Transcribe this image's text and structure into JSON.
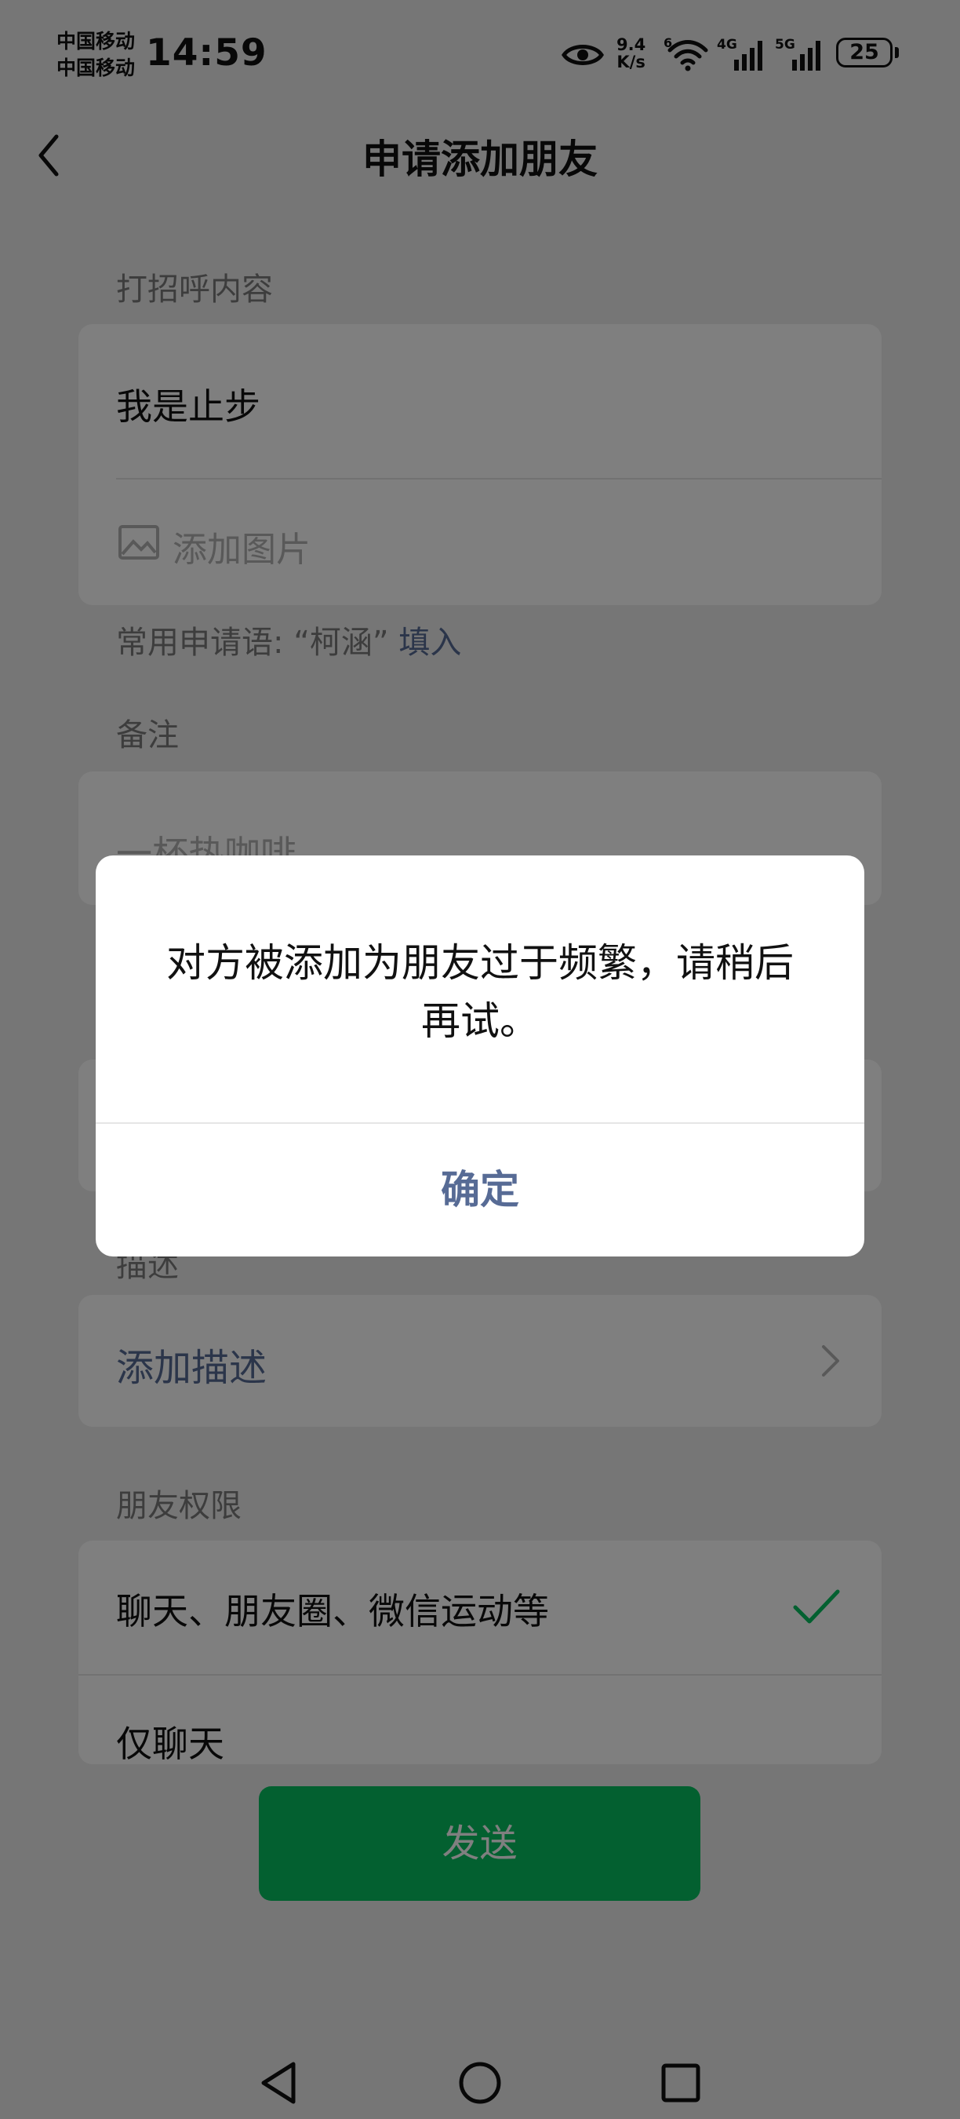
{
  "status_bar": {
    "carrier_1": "中国移动",
    "carrier_2": "中国移动",
    "time": "14:59",
    "net_speed_value": "9.4",
    "net_speed_unit": "K/s",
    "wifi_badge": "6",
    "cell_1": "4G",
    "cell_2": "5G",
    "battery": "25"
  },
  "header": {
    "title": "申请添加朋友",
    "back_icon": "chevron-left-icon"
  },
  "greeting": {
    "label": "打招呼内容",
    "value": "我是止步",
    "add_image": "添加图片"
  },
  "common_phrase": {
    "text": "常用申请语: “柯涵”",
    "fill": "填入"
  },
  "remark": {
    "label": "备注",
    "placeholder": "一杯热咖啡"
  },
  "description": {
    "label": "描述",
    "add": "添加描述"
  },
  "permissions": {
    "label": "朋友权限",
    "options": [
      {
        "label": "聊天、朋友圈、微信运动等",
        "selected": true
      },
      {
        "label": "仅聊天",
        "selected": false
      }
    ]
  },
  "send_button": "发送",
  "dialog": {
    "message": "对方被添加为朋友过于频繁，请稍后再试。",
    "confirm": "确定"
  },
  "colors": {
    "accent_green": "#07c160",
    "link_blue": "#576b95",
    "background": "#ededed"
  }
}
